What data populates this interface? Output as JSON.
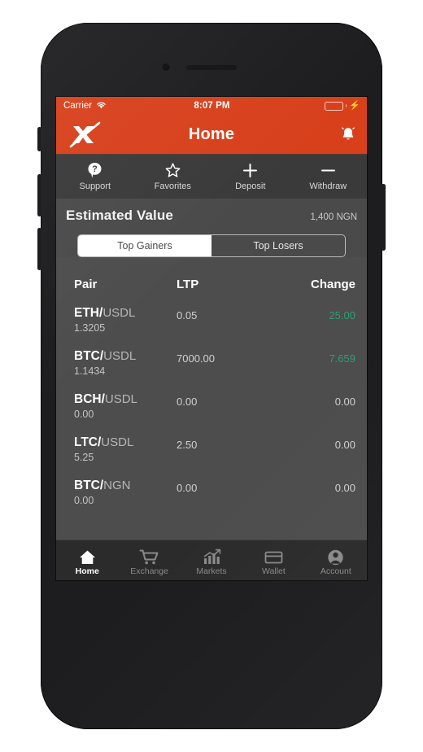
{
  "status_bar": {
    "carrier": "Carrier",
    "wifi_icon": "wifi-icon",
    "time": "8:07 PM",
    "battery_icon": "battery-full-icon",
    "charging_icon": "lightning-bolt-icon"
  },
  "header": {
    "logo_icon": "x-logo-icon",
    "title": "Home",
    "notification_icon": "bell-icon"
  },
  "quick_actions": [
    {
      "label": "Support",
      "icon": "question-mark-icon"
    },
    {
      "label": "Favorites",
      "icon": "star-outline-icon"
    },
    {
      "label": "Deposit",
      "icon": "plus-icon"
    },
    {
      "label": "Withdraw",
      "icon": "minus-icon"
    }
  ],
  "estimated_value": {
    "title": "Estimated Value",
    "amount": "1,400 NGN"
  },
  "segmented_control": {
    "options": [
      {
        "label": "Top Gainers",
        "selected": true
      },
      {
        "label": "Top Losers",
        "selected": false
      }
    ]
  },
  "market_table": {
    "columns": [
      "Pair",
      "LTP",
      "Change"
    ],
    "rows": [
      {
        "base": "ETH/",
        "quote": "USDL",
        "sub": "1.3205",
        "ltp": "0.05",
        "change": "25.00",
        "change_positive": true
      },
      {
        "base": "BTC/",
        "quote": "USDL",
        "sub": "1.1434",
        "ltp": "7000.00",
        "change": "7.659",
        "change_positive": true
      },
      {
        "base": "BCH/",
        "quote": "USDL",
        "sub": "0.00",
        "ltp": "0.00",
        "change": "0.00",
        "change_positive": false
      },
      {
        "base": "LTC/",
        "quote": "USDL",
        "sub": "5.25",
        "ltp": "2.50",
        "change": "0.00",
        "change_positive": false
      },
      {
        "base": "BTC/",
        "quote": "NGN",
        "sub": "0.00",
        "ltp": "0.00",
        "change": "0.00",
        "change_positive": false
      }
    ]
  },
  "tab_bar": [
    {
      "label": "Home",
      "icon": "home-icon",
      "active": true
    },
    {
      "label": "Exchange",
      "icon": "cart-icon",
      "active": false
    },
    {
      "label": "Markets",
      "icon": "bar-chart-icon",
      "active": false
    },
    {
      "label": "Wallet",
      "icon": "card-icon",
      "active": false
    },
    {
      "label": "Account",
      "icon": "person-icon",
      "active": false
    }
  ],
  "colors": {
    "brand_red": "#D8401C",
    "positive_green": "#2E9E74",
    "neutral_gray": "#cfcfcf",
    "screen_bg": "#4d4d4d",
    "tabbar_bg": "#2b2b2b"
  }
}
